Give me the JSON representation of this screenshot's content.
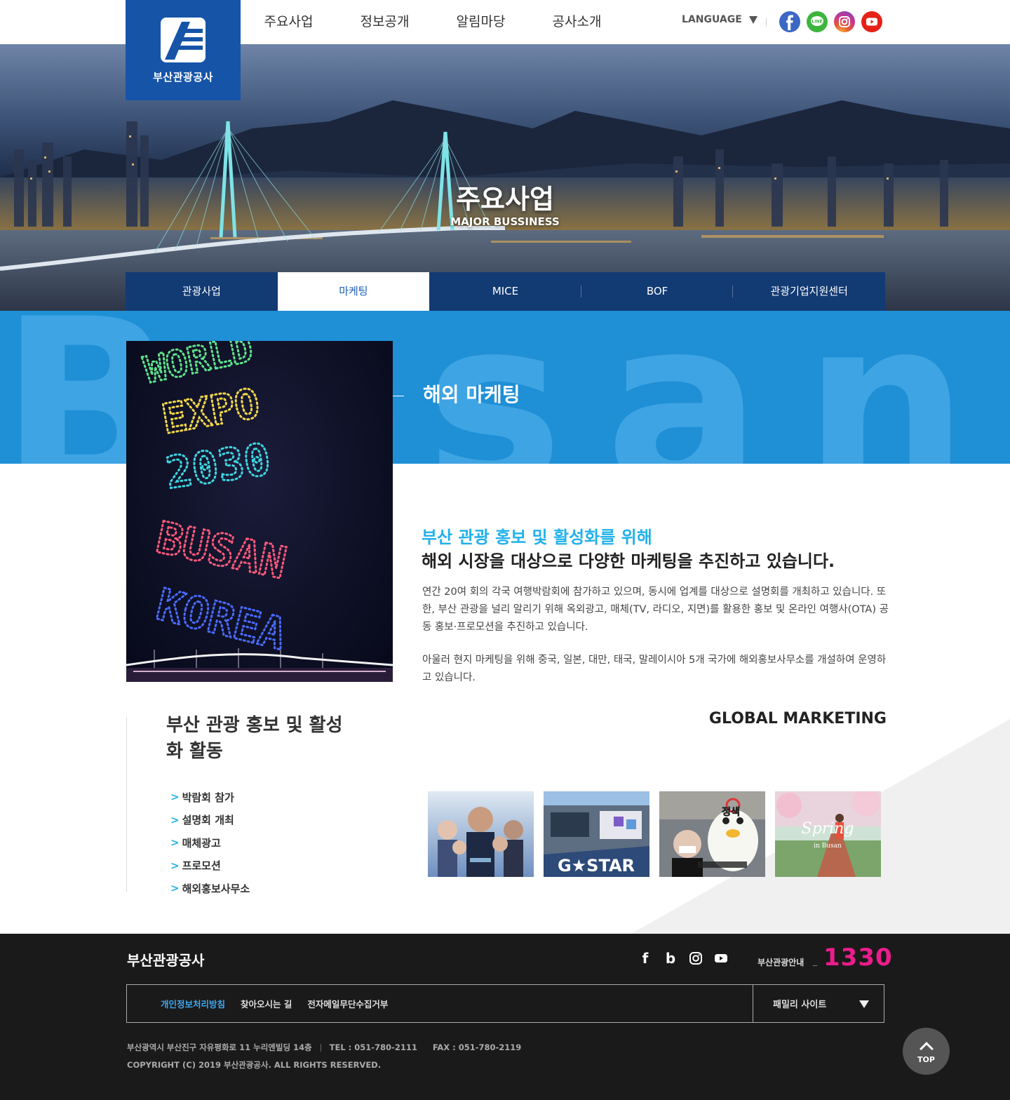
{
  "header": {
    "logo_name": "부산관광공사",
    "nav": [
      "주요사업",
      "정보공개",
      "알림마당",
      "공사소개"
    ],
    "language_label": "LANGUAGE",
    "sns": [
      {
        "icon": "facebook-icon",
        "color": "#3b68c4"
      },
      {
        "icon": "line-icon",
        "color": "#3db53d"
      },
      {
        "icon": "instagram-icon",
        "color": "#c8378f"
      },
      {
        "icon": "youtube-icon",
        "color": "#e62117"
      }
    ],
    "brand_color": "#1654a8"
  },
  "hero": {
    "title": "주요사업",
    "subtitle": "MAJOR BUSSINESS"
  },
  "subtabs": [
    "관광사업",
    "마케팅",
    "MICE",
    "BOF",
    "관광기업지원센터"
  ],
  "band": {
    "bg_text": "Busan",
    "title": "해외 마케팅",
    "color": "#1f8fd6"
  },
  "intro": {
    "lead_highlight": "부산 관광 홍보 및 활성화를 위해",
    "lead_main": "해외 시장을 대상으로 다양한 마케팅을 추진하고 있습니다.",
    "paragraph1": "연간 20여 회의 각국 여행박람회에 참가하고 있으며, 동시에 업계를 대상으로 설명회를 개최하고 있습니다. 또한, 부산 관광을 널리 알리기 위해 옥외광고, 매체(TV, 라디오, 지면)를 활용한 홍보 및 온라인 여행사(OTA) 공동 홍보·프로모션을 추진하고 있습니다.",
    "paragraph2": "아울러 현지 마케팅을 위해 중국, 일본, 대만, 태국, 말레이시아 5개 국가에 해외홍보사무소를 개설하여 운영하고 있습니다."
  },
  "activities": {
    "title": "부산 관광 홍보 및 활성화 활동",
    "items": [
      "박람회 참가",
      "설명회 개최",
      "매체광고",
      "프로모션",
      "해외홍보사무소"
    ]
  },
  "global": {
    "title": "GLOBAL MARKETING",
    "thumbs": [
      {
        "name": "thumb-celebrity-poster",
        "caption": ""
      },
      {
        "name": "thumb-gstar",
        "caption": "G★STAR"
      },
      {
        "name": "thumb-mascot",
        "caption": "정색"
      },
      {
        "name": "thumb-spring",
        "caption": "Spring",
        "caption_sub": "in Busan"
      }
    ]
  },
  "footer": {
    "logo": "부산관광공사",
    "guide_label": "부산관광안내",
    "guide_dash": "_",
    "guide_number": "1330",
    "links": [
      "개인정보처리방침",
      "찾아오시는 길",
      "전자메일무단수집거부"
    ],
    "family_site": "패밀리 사이트",
    "address": "부산광역시 부산진구 자유평화로 11 누리엔빌딩 14층",
    "tel": "TEL : 051-780-2111",
    "fax": "FAX : 051-780-2119",
    "copyright": "COPYRIGHT (C) 2019  부산관광공사. ALL RIGHTS RESERVED.",
    "top_label": "TOP"
  },
  "drone_text": [
    "WORLD",
    "EXPO",
    "2030",
    "BUSAN",
    "KOREA"
  ]
}
